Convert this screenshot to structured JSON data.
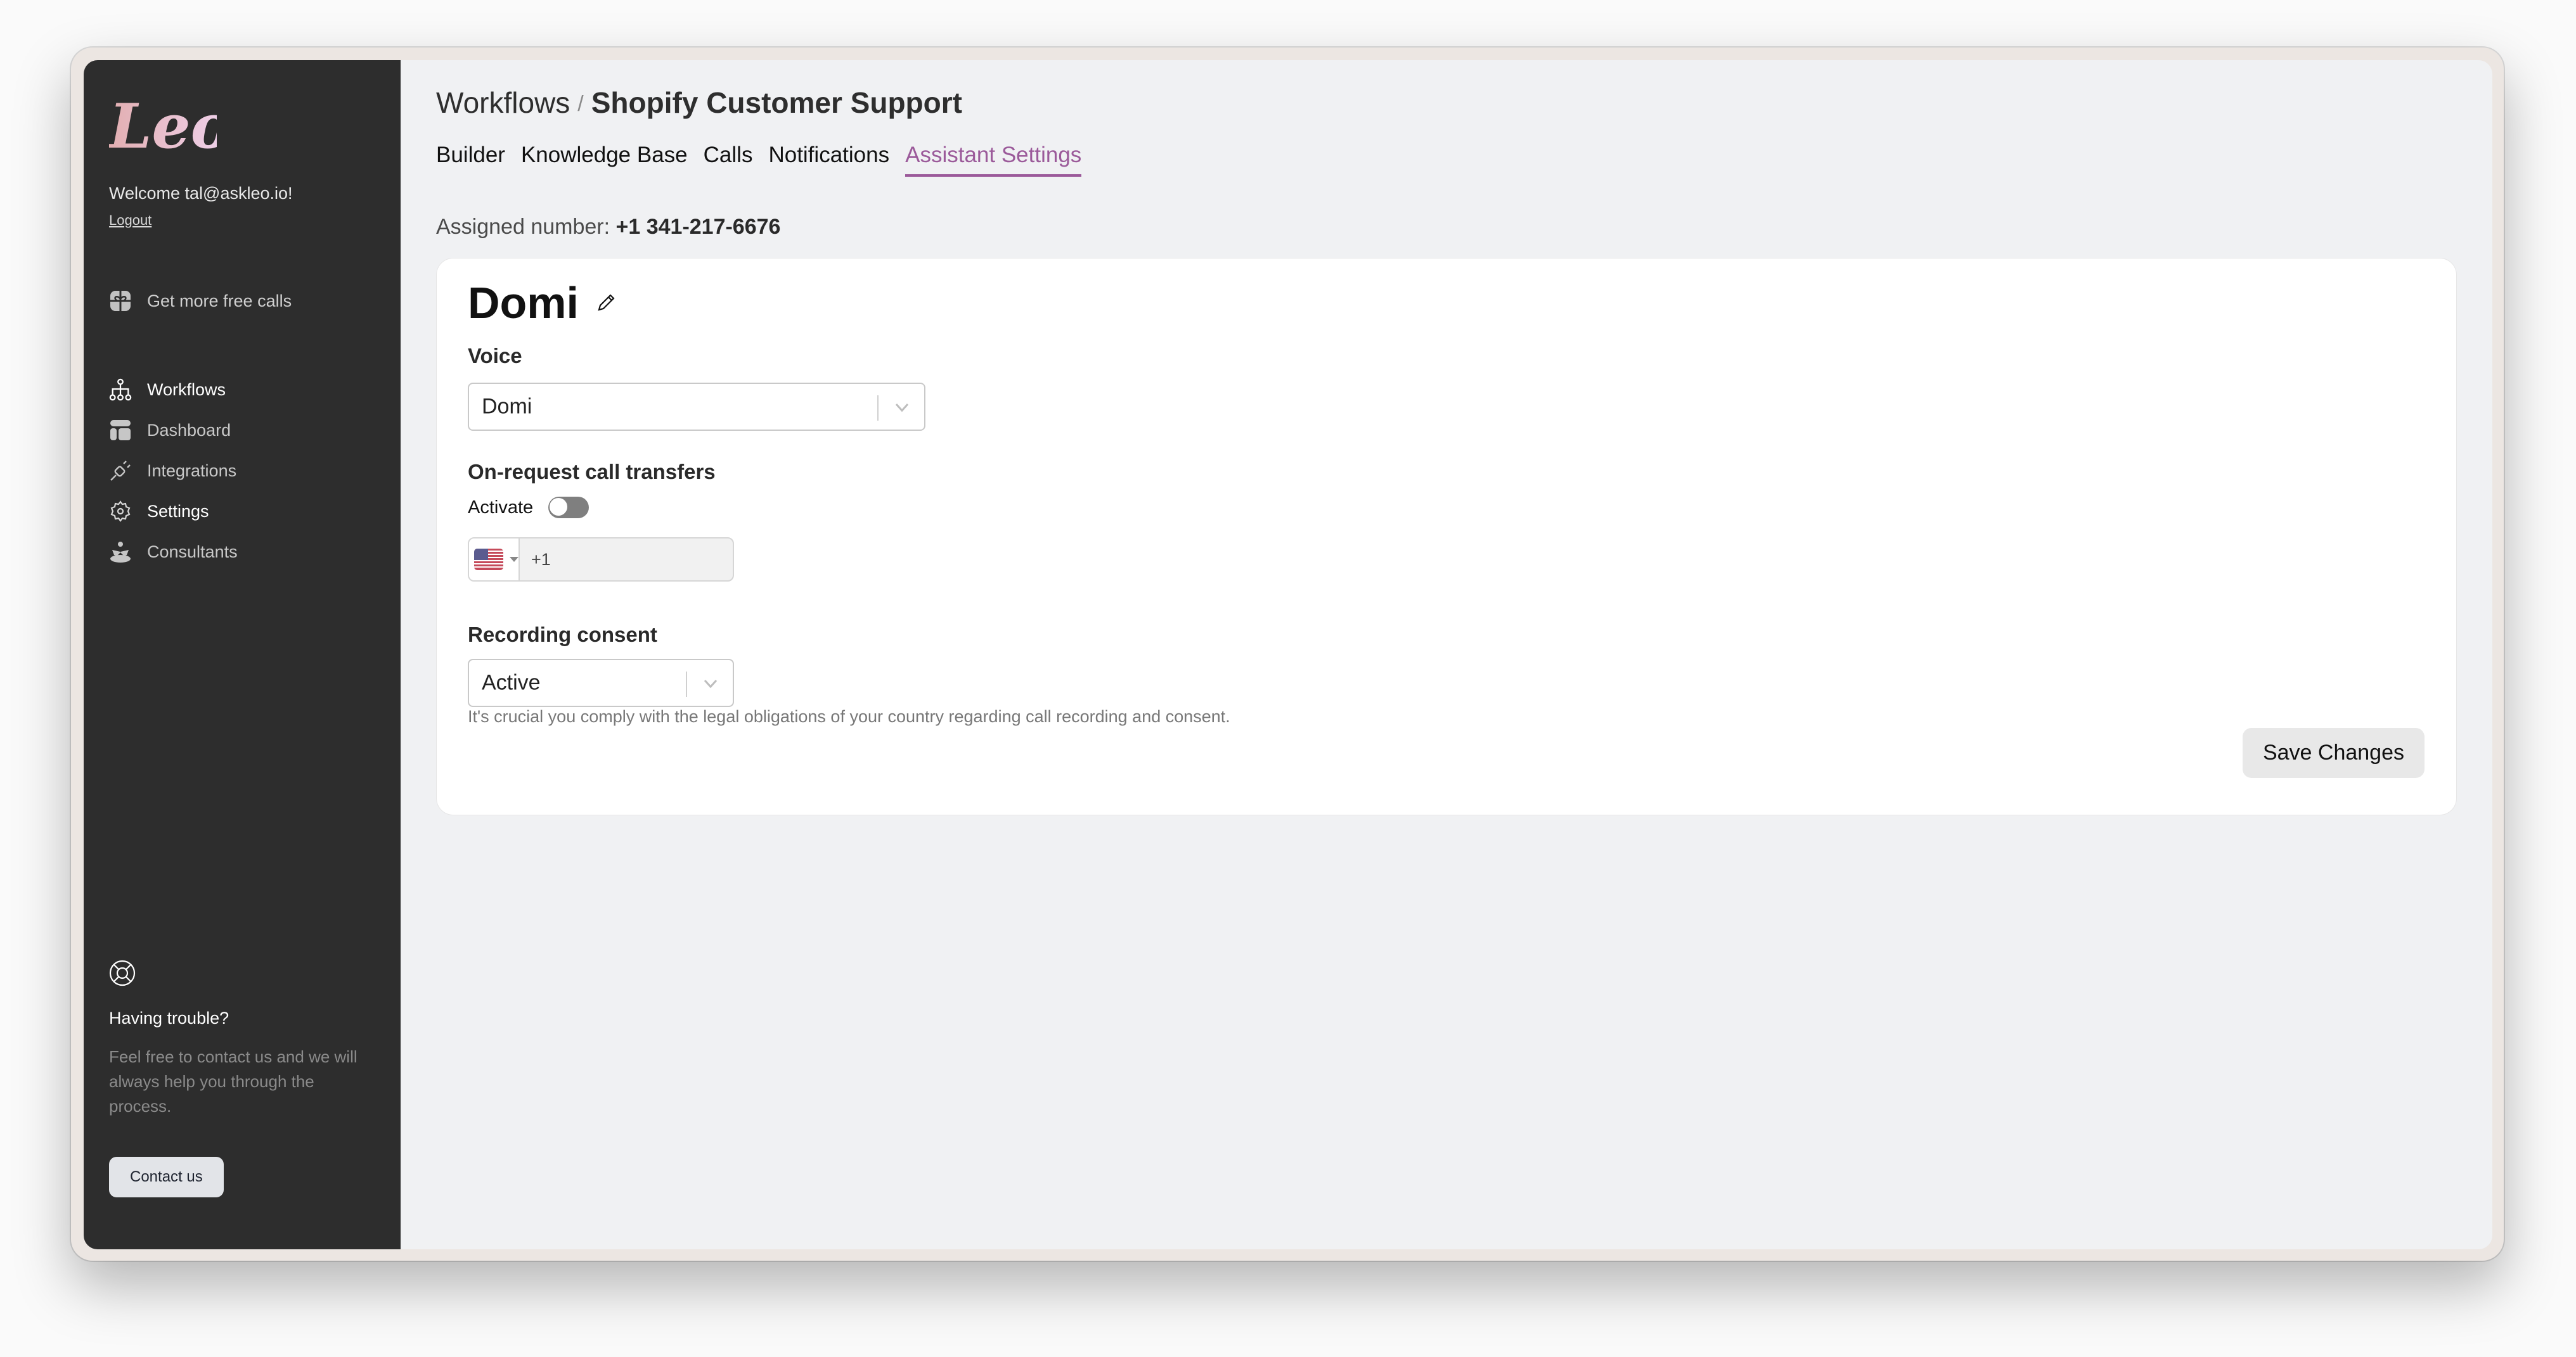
{
  "app": {
    "logo_text": "Leo",
    "brand_gradient": [
      "#e2aeb0",
      "#f0d3ee"
    ],
    "accent_color": "#9b5a9a"
  },
  "sidebar": {
    "welcome": "Welcome tal@askleo.io!",
    "logout_label": "Logout",
    "promo_label": "Get more free calls",
    "items": [
      {
        "label": "Workflows",
        "icon": "workflow-tree-icon",
        "active": true
      },
      {
        "label": "Dashboard",
        "icon": "dashboard-layout-icon",
        "active": false
      },
      {
        "label": "Integrations",
        "icon": "plug-icon",
        "active": false
      },
      {
        "label": "Settings",
        "icon": "gear-icon",
        "active": true
      },
      {
        "label": "Consultants",
        "icon": "consultant-person-icon",
        "active": false
      }
    ],
    "help": {
      "icon": "lifebuoy-icon",
      "title": "Having trouble?",
      "text": "Feel free to contact us and we will always help you through the process.",
      "button_label": "Contact us"
    }
  },
  "header": {
    "breadcrumb_root": "Workflows",
    "breadcrumb_separator": "/",
    "breadcrumb_current": "Shopify Customer Support",
    "tabs": [
      {
        "label": "Builder",
        "active": false
      },
      {
        "label": "Knowledge Base",
        "active": false
      },
      {
        "label": "Calls",
        "active": false
      },
      {
        "label": "Notifications",
        "active": false
      },
      {
        "label": "Assistant Settings",
        "active": true
      }
    ],
    "assigned_label": "Assigned number:",
    "assigned_number": "+1 341-217-6676"
  },
  "assistant": {
    "name": "Domi",
    "voice_label": "Voice",
    "voice_value": "Domi",
    "transfers_label": "On-request call transfers",
    "activate_label": "Activate",
    "activate_on": false,
    "phone_country": "US",
    "phone_value": "+1",
    "recording_label": "Recording consent",
    "recording_value": "Active",
    "recording_hint": "It's crucial you comply with the legal obligations of your country regarding call recording and consent.",
    "save_label": "Save Changes"
  }
}
